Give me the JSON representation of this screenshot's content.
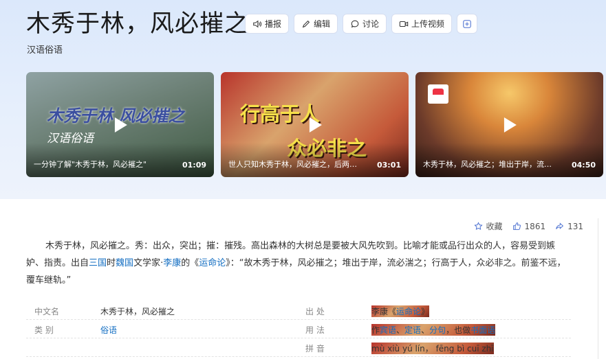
{
  "header": {
    "title": "木秀于林，风必摧之",
    "subtitle": "汉语俗语",
    "actions": {
      "broadcast": "播报",
      "edit": "编辑",
      "discuss": "讨论",
      "upload_video": "上传视频"
    }
  },
  "videos": [
    {
      "overlay_a": "木秀于林  风必摧之",
      "overlay_b": "汉语俗语",
      "title": "一分钟了解\"木秀于林，风必摧之\"",
      "duration": "01:09"
    },
    {
      "overlay_a": "行高于人",
      "overlay_b": "众必非之",
      "title": "世人只知木秀于林，风必摧之，后两…",
      "duration": "03:01"
    },
    {
      "title": "木秀于林，风必摧之；堆出于岸，流…",
      "duration": "04:50"
    }
  ],
  "stats": {
    "collect_label": "收藏",
    "likes": "1861",
    "shares": "131"
  },
  "summary": {
    "part1": "木秀于林，风必摧之。秀：出众，突出；摧：摧残。高出森林的大树总是要被大风先吹到。比喻才能或品行出众的人，容易受到嫉妒、指责。出自",
    "link_sanguo": "三国",
    "part2": "时",
    "link_weiguo": "魏国",
    "part3": "文学家·",
    "link_likang": "李康",
    "part4": "的《",
    "link_yunminglun": "运命论",
    "part5": "》：“故木秀于林，风必摧之；堆出于岸，流必湍之；行高于人，众必非之。前鉴不远，覆车继轨。”"
  },
  "info": {
    "cn_name_key": "中文名",
    "cn_name_val": "木秀于林，风必摧之",
    "source_key": "出    处",
    "source_val_prefix": "李康《",
    "source_link": "运命论",
    "source_val_suffix": "》",
    "category_key": "类    别",
    "category_link": "俗语",
    "usage_key": "用    法",
    "usage_prefix": "作",
    "usage_link1": "宾语",
    "usage_sep1": "、",
    "usage_link2": "定语",
    "usage_sep2": "、",
    "usage_link3": "分句",
    "usage_mid": "，也做",
    "usage_link4": "书面语",
    "pinyin_key": "拼    音",
    "pinyin_val": "mù xiù yú lín， fēng bì cuī zhī"
  }
}
